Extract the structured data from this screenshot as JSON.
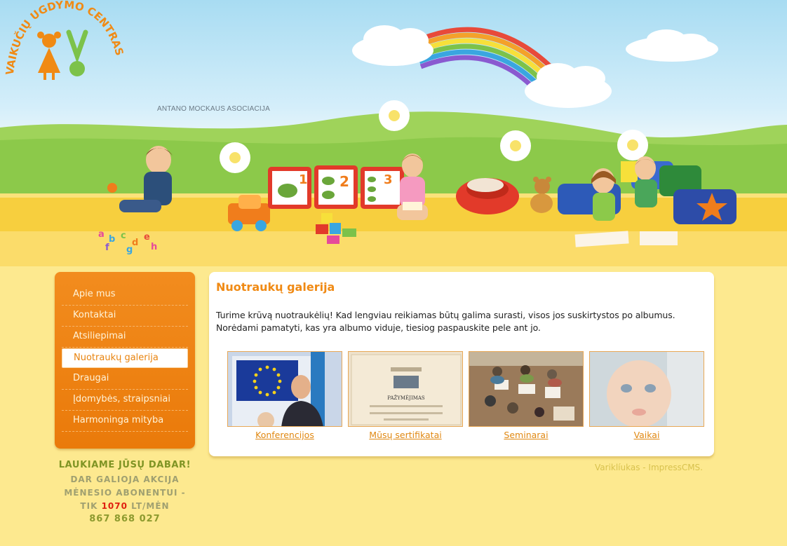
{
  "logo": {
    "title": "VAIKUČIŲ UGDYMO CENTRAS",
    "subtitle": "ANTANO MOCKAUS ASOCIACIJA"
  },
  "menu": [
    {
      "label": "Apie mus",
      "active": false
    },
    {
      "label": "Kontaktai",
      "active": false
    },
    {
      "label": "Atsiliepimai",
      "active": false
    },
    {
      "label": "Nuotraukų galerija",
      "active": true
    },
    {
      "label": "Draugai",
      "active": false
    },
    {
      "label": "Įdomybės, straipsniai",
      "active": false
    },
    {
      "label": "Harmoninga mityba",
      "active": false
    }
  ],
  "promo": {
    "line1": "LAUKIAME JŪSŲ DABAR!",
    "line2": "DAR GALIOJA AKCIJA",
    "line3": "MĖNESIO ABONENTUI -",
    "line4_prefix": "TIK",
    "price": "1070",
    "line4_suffix": "LT/MĖN",
    "phone": "867 868 027"
  },
  "main": {
    "title": "Nuotraukų galerija",
    "intro": "Turime krūvą nuotraukėlių! Kad lengviau reikiamas būtų galima surasti, visos jos suskirtystos po albumus. Norėdami pamatyti, kas yra albumo viduje, tiesiog paspauskite pele ant jo.",
    "albums": [
      {
        "label": "Konferencijos",
        "thumb_text": "EUROPOS KOMIS... ATSTOVYBĖ LIETU..."
      },
      {
        "label": "Mūsų sertifikatai",
        "thumb_text": "PAŽYMĖJIMAS"
      },
      {
        "label": "Seminarai"
      },
      {
        "label": "Vaikai"
      }
    ]
  },
  "footer": {
    "credit": "Variklíukas - ImpressCMS."
  },
  "colors": {
    "accent": "#f08a14",
    "background": "#fde98f",
    "sidebar": "#ee8414",
    "promo_price": "#e02010"
  }
}
